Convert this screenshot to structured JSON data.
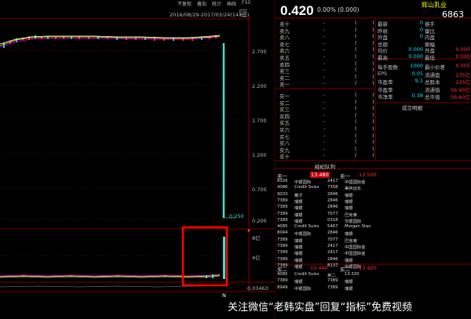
{
  "toolbar": {
    "items": [
      "不复权",
      "叠加",
      "统计",
      "画线",
      "F10",
      "标记",
      "+自选",
      "返回"
    ]
  },
  "chart": {
    "range": "2016/08/29-2017/03/24(141日)",
    "range_box": "□",
    "price_axis": [
      "2.700",
      "2.200",
      "1.700",
      "1.200",
      "0.700",
      "0.200"
    ],
    "low_label": "0.250",
    "volume_axis": [
      "8亿",
      "4亿"
    ],
    "bottom_value": "0.03463",
    "bottom_marker": "N"
  },
  "quote": {
    "price": "0.420",
    "change": "0.00% (0.000)",
    "name": "辉山乳业",
    "code": "6863"
  },
  "order_book": {
    "sell": [
      "卖十",
      "卖九",
      "卖八",
      "卖七",
      "卖六",
      "卖五",
      "卖四",
      "卖三",
      "卖二",
      "卖一"
    ],
    "buy": [
      "买一",
      "买二",
      "买三",
      "买四",
      "买五",
      "买六",
      "买七",
      "买八",
      "买九",
      "买十"
    ],
    "dash": "-",
    "paren": "(",
    "paren_close": ")"
  },
  "stats_top": [
    {
      "k": "最新",
      "v": "0",
      "k2": "换手",
      "v2": ""
    },
    {
      "k": "昨收",
      "v": "0",
      "k2": "量比",
      "v2": ""
    },
    {
      "k": "外盘",
      "v": "0",
      "k2": "内盘",
      "v2": ""
    },
    {
      "k": "总额",
      "v": "",
      "k2": "振幅",
      "v2": ""
    },
    {
      "k": "均价",
      "v": "0.000",
      "k2": "开盘",
      "v2": "0.000"
    },
    {
      "k": "最高",
      "v": "0.000",
      "k2": "最低",
      "v2": "0.000"
    }
  ],
  "stats_bottom": [
    {
      "k": "每手股数",
      "v": "1000",
      "k2": "最小价差",
      "v2": "0.005"
    },
    {
      "k": "EPS",
      "v": "0.05",
      "k2": "流通盘",
      "v2": "135亿"
    },
    {
      "k": "市盈率",
      "v": "9.1",
      "k2": "总股本",
      "v2": "135亿"
    },
    {
      "k": "市盈率",
      "v": "",
      "k2": "流通值",
      "v2": "56.60亿"
    },
    {
      "k": "市净率",
      "v": "0.38",
      "k2": "总市值",
      "v2": "56.60亿"
    }
  ],
  "stats_footer": "成交明细",
  "broker_queue": {
    "title": "经纪队列",
    "sell_header": {
      "label": "卖一",
      "price": "13.480",
      "label2": "卖一",
      "price2": "13.500"
    },
    "rows": [
      [
        "8026",
        "中银国际",
        "2417",
        "中国国际金"
      ],
      [
        "4086",
        "Credit Suiss",
        "7358",
        "美林远东"
      ],
      [
        "9033",
        "耀才",
        "2846",
        "瑞银"
      ],
      [
        "7389",
        "瑞银",
        "2846",
        "瑞银"
      ],
      [
        "7389",
        "瑞银",
        "2846",
        "瑞银"
      ],
      [
        "7389",
        "瑞银",
        "7077",
        "巴克莱"
      ],
      [
        "7389",
        "瑞银",
        "0318",
        "交银国际"
      ],
      [
        "4085",
        "Credit Suiss",
        "5467",
        "Morgan Stan"
      ],
      [
        "8044",
        "中银国际",
        "2846",
        "瑞银"
      ],
      [
        "7389",
        "瑞银",
        "7077",
        "巴克莱"
      ],
      [
        "7389",
        "瑞银",
        "2417",
        "中国国际金"
      ],
      [
        "7389",
        "瑞银",
        "2417",
        "中国国际金"
      ],
      [
        "7389",
        "瑞银",
        "2846",
        "瑞银"
      ],
      [
        "7389",
        "瑞银",
        "8137",
        "中银国际"
      ]
    ],
    "buy_header": {
      "label": "买二",
      "price": "13.440",
      "label2": "买二",
      "price2": "13.420"
    },
    "rows2": [
      [
        "4085",
        "Credit Suiss",
        "卖二",
        "13.320"
      ],
      [
        "7389",
        "瑞银",
        "7389",
        "瑞银"
      ],
      [
        "8949",
        "中银国际",
        "7389",
        "瑞银"
      ]
    ]
  },
  "watermark": "关注微信“老韩实盘”回复“指标”免费视频",
  "colors": {
    "sell": "#00e5ff",
    "buy": "#ff3030",
    "highlight": "#ff0000",
    "price_line": "#40e0d0"
  }
}
